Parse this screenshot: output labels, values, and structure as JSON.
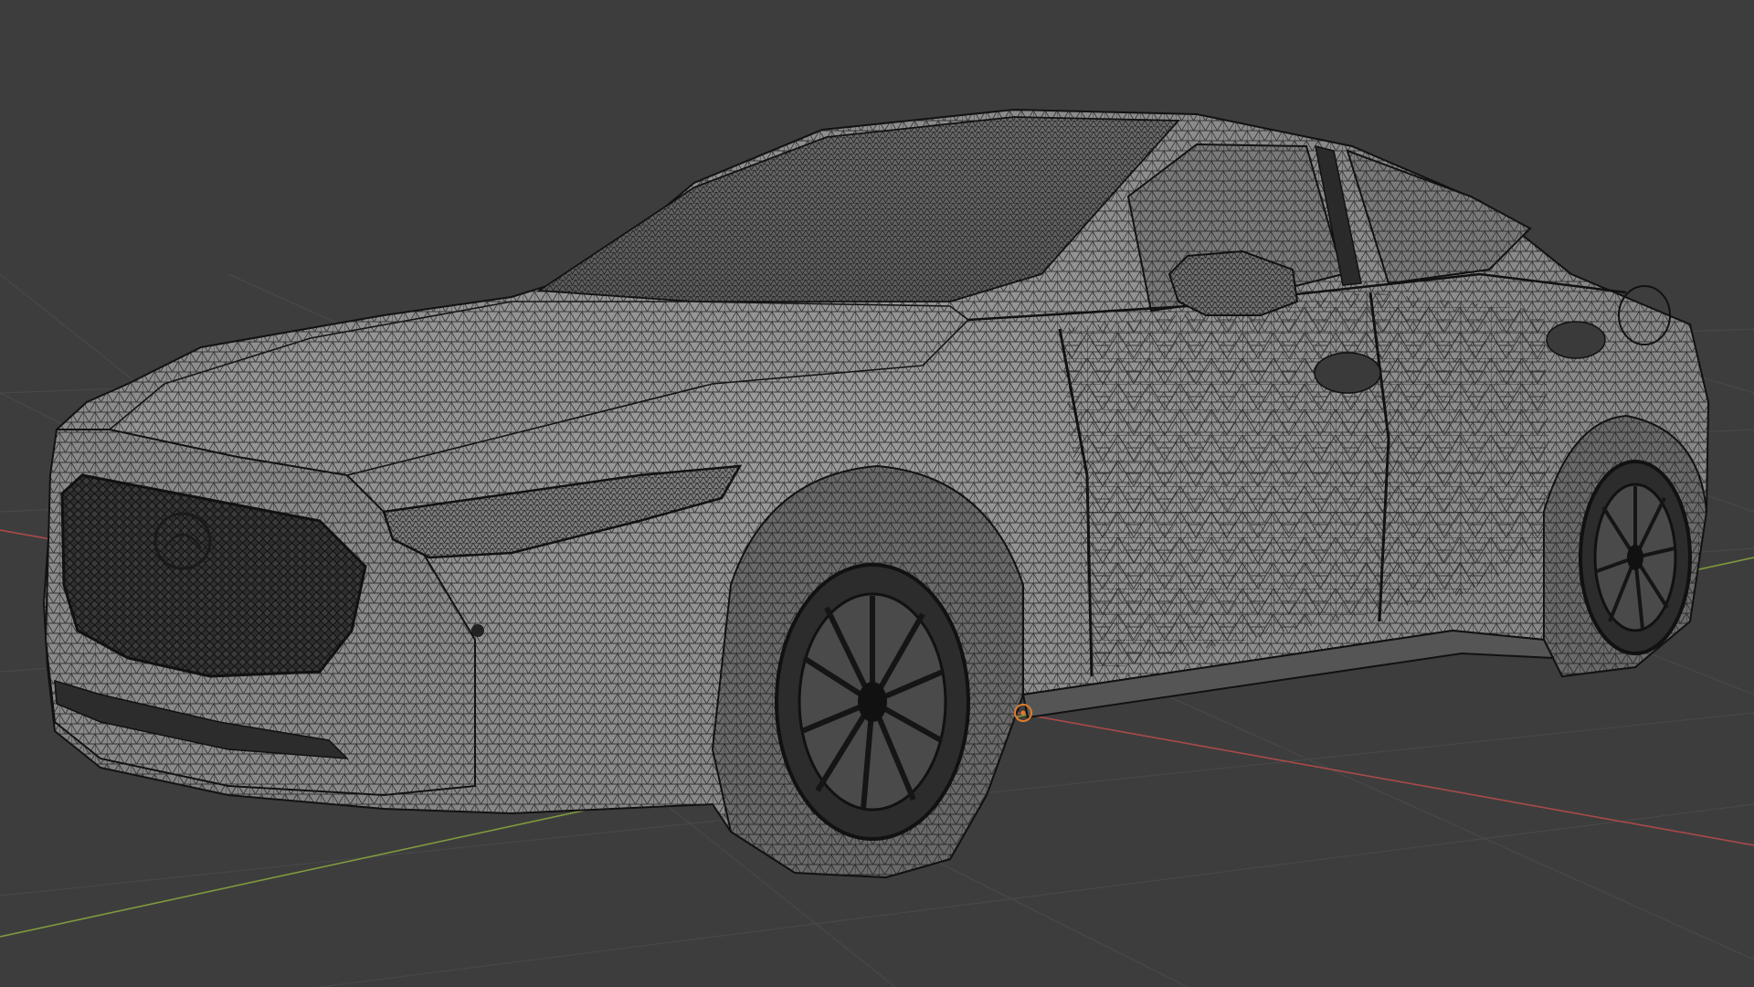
{
  "viewport": {
    "background_color": "#3d3d3d",
    "grid_line_color": "#484848",
    "x_axis_color": "#a84a4a",
    "y_axis_color": "#7f9a3e",
    "shading_mode": "wireframe",
    "grid_visible": true
  },
  "model": {
    "object": "hatchback car",
    "body_color": "#8e8e8e",
    "wire_color": "#1b1b1b",
    "origin_marker_color": "#e07c2c"
  }
}
